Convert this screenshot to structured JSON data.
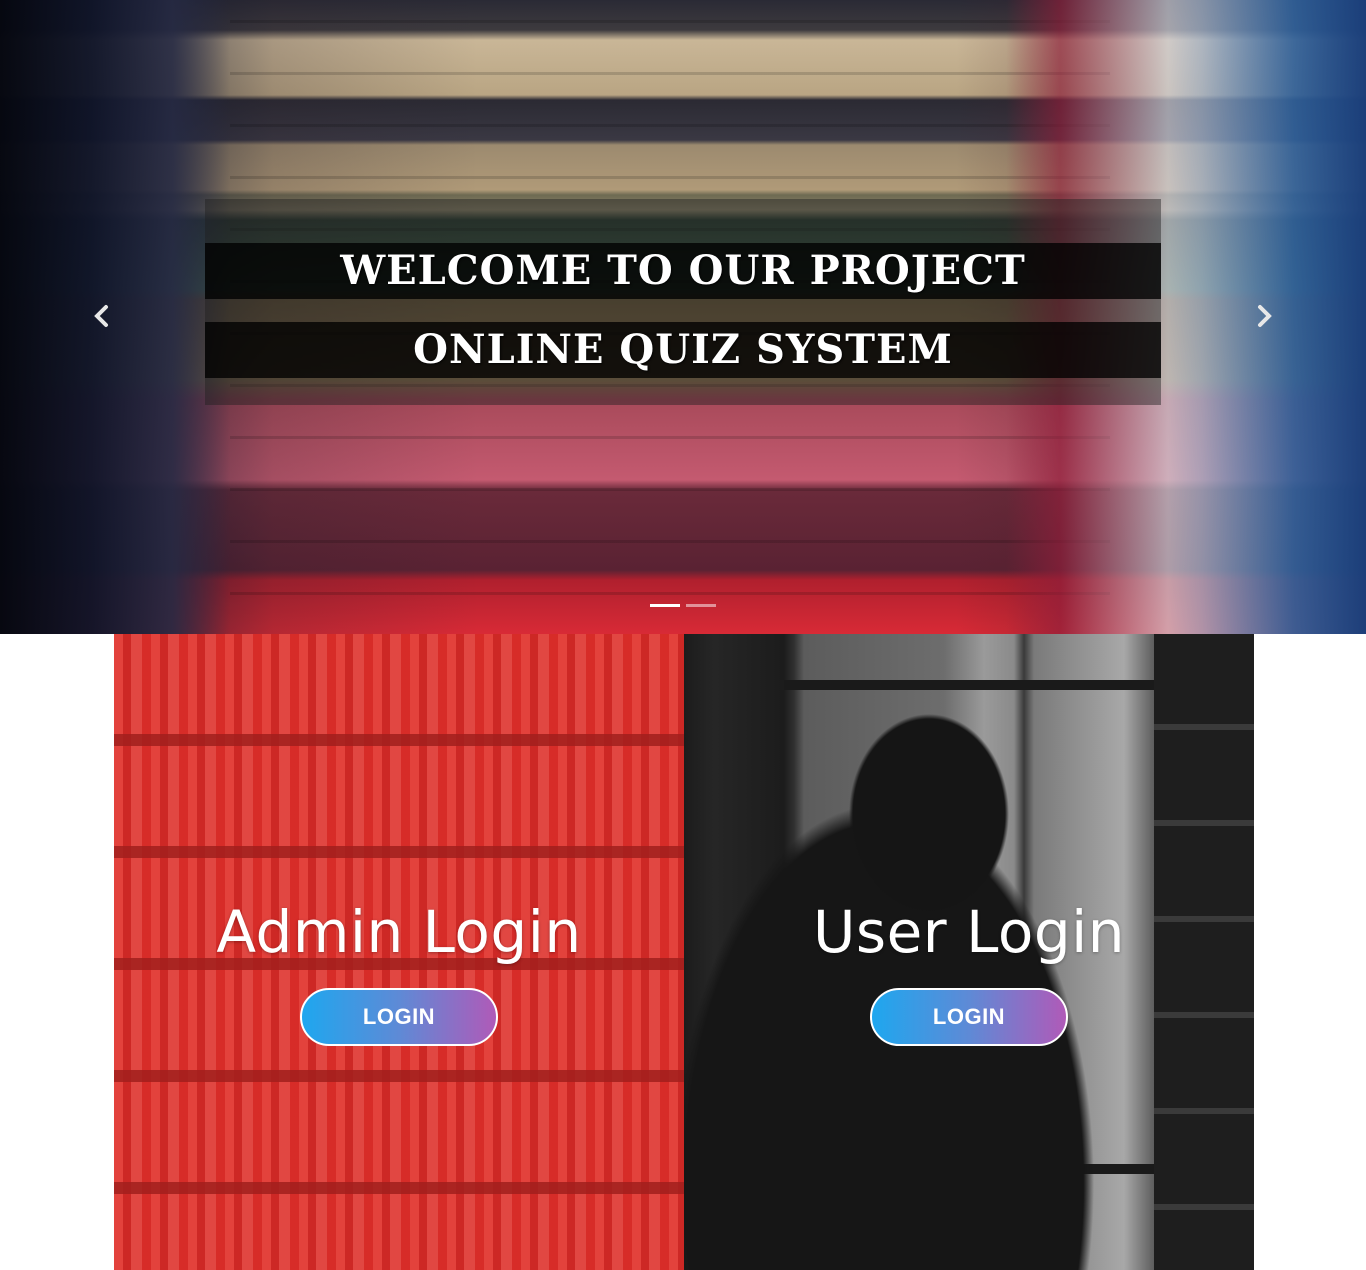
{
  "hero": {
    "line1": "WELCOME TO OUR PROJECT",
    "line2": "ONLINE QUIZ SYSTEM",
    "prev_icon": "chevron-left-icon",
    "next_icon": "chevron-right-icon",
    "slide_count": 2,
    "active_slide": 1
  },
  "panels": {
    "admin": {
      "title": "Admin Login",
      "button_label": "LOGIN",
      "overlay_color": "#d8302c"
    },
    "user": {
      "title": "User Login",
      "button_label": "LOGIN",
      "overlay_color": "#2a2a2a"
    }
  },
  "colors": {
    "button_gradient_start": "#1ea7ef",
    "button_gradient_end": "#b05ab8",
    "caption_bg": "#000000"
  }
}
